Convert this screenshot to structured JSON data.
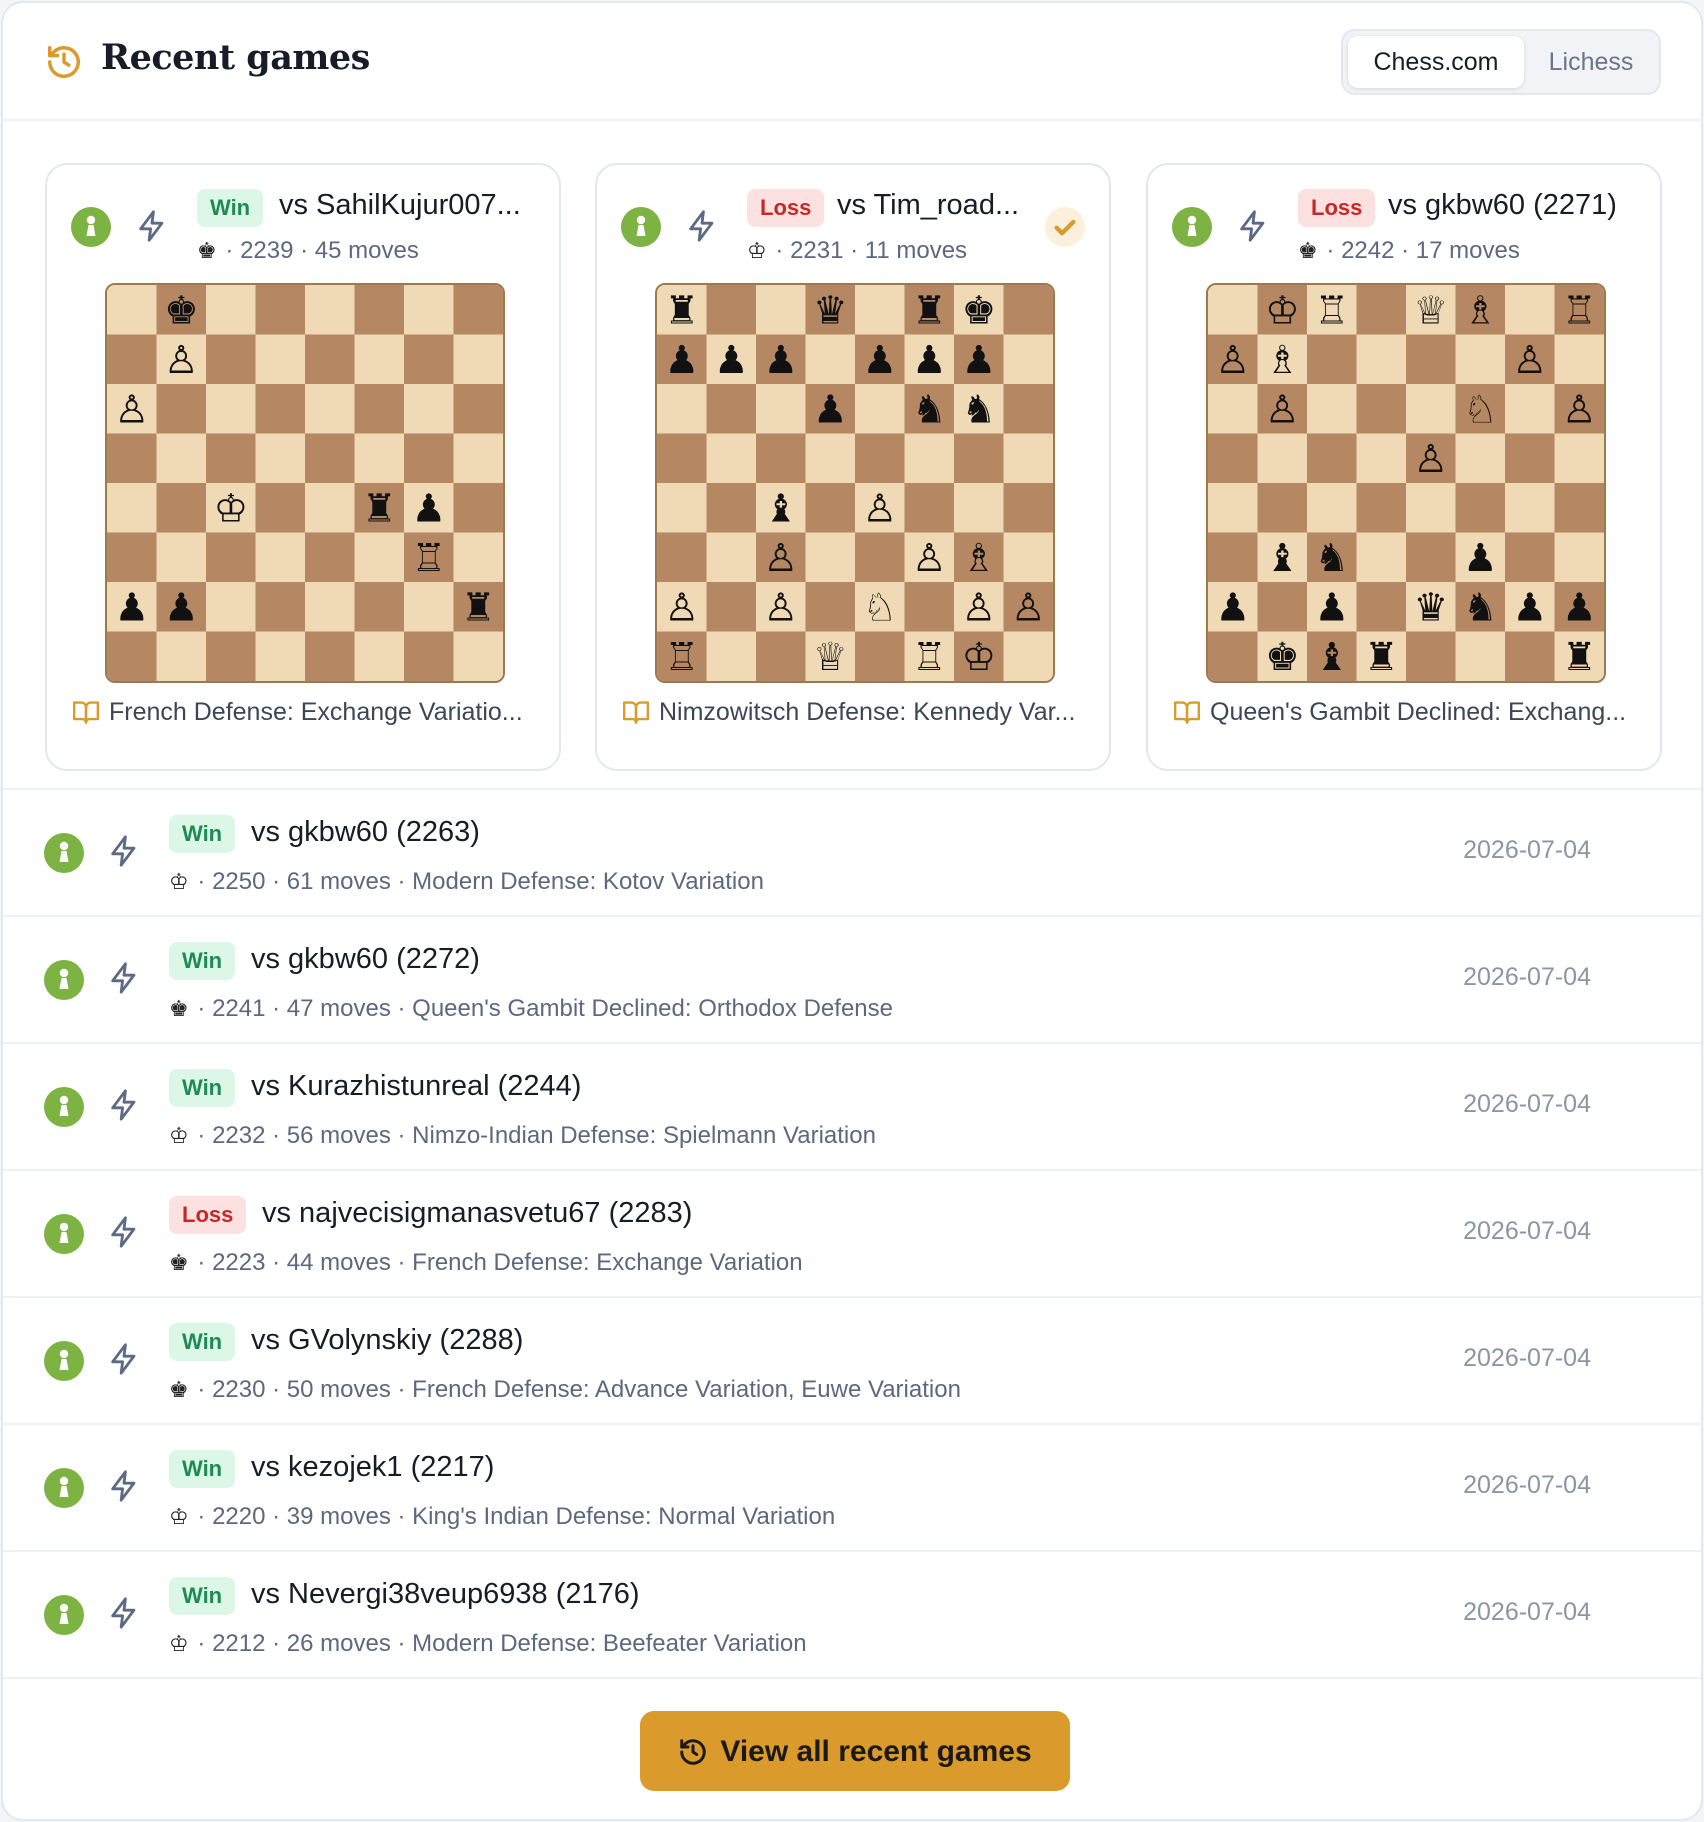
{
  "header": {
    "title": "Recent games",
    "icon": "history-icon",
    "tabs": [
      {
        "label": "Chess.com",
        "active": true
      },
      {
        "label": "Lichess",
        "active": false
      }
    ]
  },
  "colors": {
    "accent": "#db9b2c",
    "win_bg": "#dcf7e8",
    "win_text": "#1f8a54",
    "loss_bg": "#fde1e1",
    "loss_text": "#c62828",
    "pawn_badge": "#7cb342",
    "board_light": "#f0d9b5",
    "board_dark": "#b58863"
  },
  "featured": [
    {
      "result": "Win",
      "opponent": "vs SahilKujur007...",
      "player_color": "black",
      "rating": "2239",
      "moves": "45 moves",
      "opening": "French Defense: Exchange Variatio...",
      "reviewed": false,
      "board": [
        "1k6",
        "1P6",
        "P7",
        "8",
        "2K2rp1",
        "6R1",
        "pp5r",
        "8"
      ]
    },
    {
      "result": "Loss",
      "opponent": "vs Tim_road...",
      "player_color": "white",
      "rating": "2231",
      "moves": "11 moves",
      "opening": "Nimzowitsch Defense: Kennedy Var...",
      "reviewed": true,
      "board": [
        "r2q1rk1",
        "ppp1ppp1",
        "3p1nn1",
        "8",
        "2b1P3",
        "2P2PB1",
        "P1P1N1PP",
        "R2Q1RK1"
      ]
    },
    {
      "result": "Loss",
      "opponent": "vs gkbw60 (2271)",
      "player_color": "black",
      "rating": "2242",
      "moves": "17 moves",
      "opening": "Queen's Gambit Declined: Exchang...",
      "reviewed": false,
      "board": [
        "1KR1QB1R",
        "PB4P1",
        "1P3N1P",
        "4P3",
        "8",
        "1bn2p2",
        "p1p1qnpp",
        "1kbr3r"
      ]
    }
  ],
  "games": [
    {
      "result": "Win",
      "opponent": "vs gkbw60 (2263)",
      "player_color": "white",
      "rating": "2250",
      "details": "61 moves · Modern Defense: Kotov Variation",
      "date": "2026-07-04"
    },
    {
      "result": "Win",
      "opponent": "vs gkbw60 (2272)",
      "player_color": "black",
      "rating": "2241",
      "details": "47 moves · Queen's Gambit Declined: Orthodox Defense",
      "date": "2026-07-04"
    },
    {
      "result": "Win",
      "opponent": "vs Kurazhistunreal (2244)",
      "player_color": "white",
      "rating": "2232",
      "details": "56 moves · Nimzo-Indian Defense: Spielmann Variation",
      "date": "2026-07-04"
    },
    {
      "result": "Loss",
      "opponent": "vs najvecisigmanasvetu67 (2283)",
      "player_color": "black",
      "rating": "2223",
      "details": "44 moves · French Defense: Exchange Variation",
      "date": "2026-07-04"
    },
    {
      "result": "Win",
      "opponent": "vs GVolynskiy (2288)",
      "player_color": "black",
      "rating": "2230",
      "details": "50 moves · French Defense: Advance Variation, Euwe Variation",
      "date": "2026-07-04"
    },
    {
      "result": "Win",
      "opponent": "vs kezojek1 (2217)",
      "player_color": "white",
      "rating": "2220",
      "details": "39 moves · King's Indian Defense: Normal Variation",
      "date": "2026-07-04"
    },
    {
      "result": "Win",
      "opponent": "vs Nevergi38veup6938 (2176)",
      "player_color": "white",
      "rating": "2212",
      "details": "26 moves · Modern Defense: Beefeater Variation",
      "date": "2026-07-04"
    }
  ],
  "footer": {
    "cta_label": "View all recent games",
    "cta_icon": "history-icon"
  }
}
